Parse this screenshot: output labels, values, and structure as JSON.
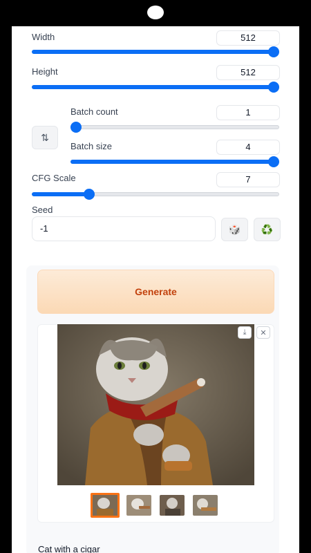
{
  "settings": {
    "width": {
      "label": "Width",
      "value": "512",
      "fraction": 1.0
    },
    "height": {
      "label": "Height",
      "value": "512",
      "fraction": 1.0
    },
    "batch_count": {
      "label": "Batch count",
      "value": "1",
      "fraction": 0.0
    },
    "batch_size": {
      "label": "Batch size",
      "value": "4",
      "fraction": 1.0
    },
    "cfg_scale": {
      "label": "CFG Scale",
      "value": "7",
      "fraction": 0.22
    },
    "seed": {
      "label": "Seed",
      "value": "-1"
    },
    "swap_icon": "⇅",
    "dice_icon": "🎲",
    "recycle_icon": "♻️"
  },
  "generate": {
    "label": "Generate"
  },
  "gallery": {
    "download_icon": "⤓",
    "close_icon": "✕",
    "caption": "Cat with a cigar"
  },
  "colors": {
    "accent": "#0b6ef5",
    "generate_text": "#c2410c"
  }
}
